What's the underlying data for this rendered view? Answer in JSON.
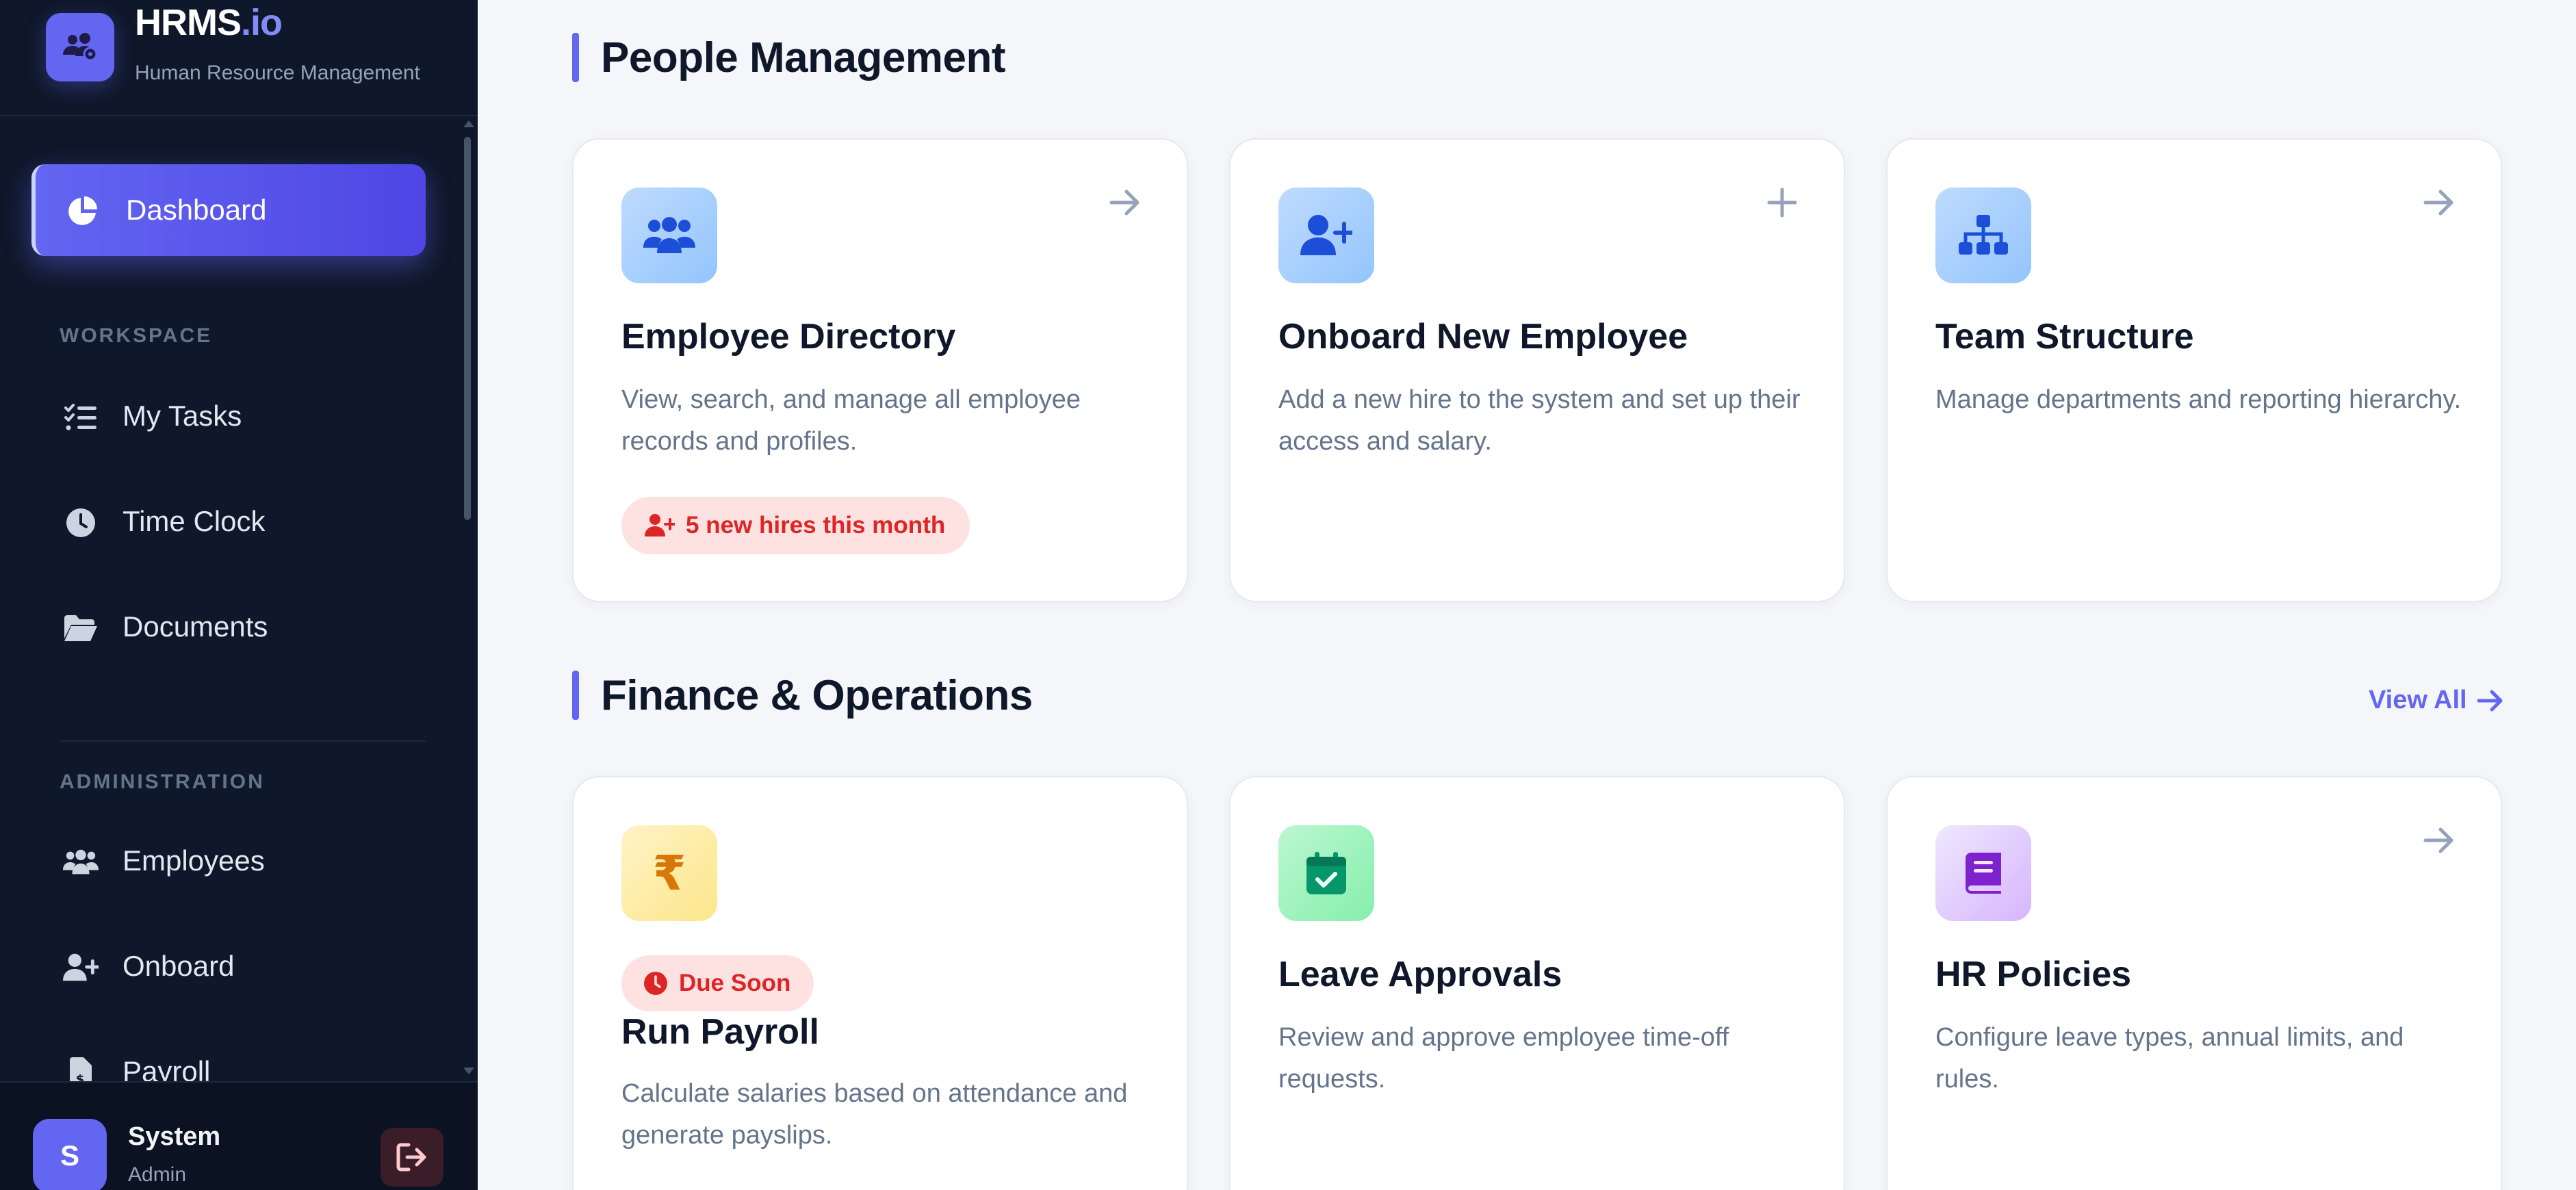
{
  "brand": {
    "name_main": "HRMS",
    "name_accent": ".io",
    "subtitle": "Human Resource Management"
  },
  "sidebar": {
    "active": {
      "label": "Dashboard",
      "icon": "pie-chart-icon"
    },
    "sections": [
      {
        "label": "WORKSPACE",
        "items": [
          {
            "label": "My Tasks",
            "icon": "task-list-icon"
          },
          {
            "label": "Time Clock",
            "icon": "clock-icon"
          },
          {
            "label": "Documents",
            "icon": "folder-open-icon"
          }
        ]
      },
      {
        "label": "ADMINISTRATION",
        "items": [
          {
            "label": "Employees",
            "icon": "users-icon"
          },
          {
            "label": "Onboard",
            "icon": "user-plus-icon"
          },
          {
            "label": "Payroll",
            "icon": "invoice-icon"
          }
        ]
      }
    ]
  },
  "user": {
    "initial": "S",
    "name": "System",
    "role": "Admin"
  },
  "main": {
    "people": {
      "title": "People Management",
      "cards": [
        {
          "title": "Employee Directory",
          "desc": "View, search, and manage all employee records and profiles.",
          "pill": "5 new hires this month",
          "icon": "users-icon",
          "corner": "arrow-right-icon"
        },
        {
          "title": "Onboard New Employee",
          "desc": "Add a new hire to the system and set up their access and salary.",
          "icon": "user-plus-icon",
          "corner": "plus-icon"
        },
        {
          "title": "Team Structure",
          "desc": "Manage departments and reporting hierarchy.",
          "icon": "org-chart-icon",
          "corner": "arrow-right-icon"
        }
      ]
    },
    "finance": {
      "title": "Finance & Operations",
      "view_all": "View All",
      "cards": [
        {
          "title": "Run Payroll",
          "desc": "Calculate salaries based on attendance and generate payslips.",
          "pill": "Due Soon",
          "icon": "rupee-icon"
        },
        {
          "title": "Leave Approvals",
          "desc": "Review and approve employee time-off requests.",
          "icon": "calendar-check-icon"
        },
        {
          "title": "HR Policies",
          "desc": "Configure leave types, annual limits, and rules.",
          "icon": "book-icon",
          "corner": "arrow-right-icon"
        }
      ]
    }
  },
  "colors": {
    "sidebar_bg": "#0f172a",
    "accent": "#6366f1",
    "page_bg": "#f4f6fa",
    "danger": "#dc2626"
  }
}
